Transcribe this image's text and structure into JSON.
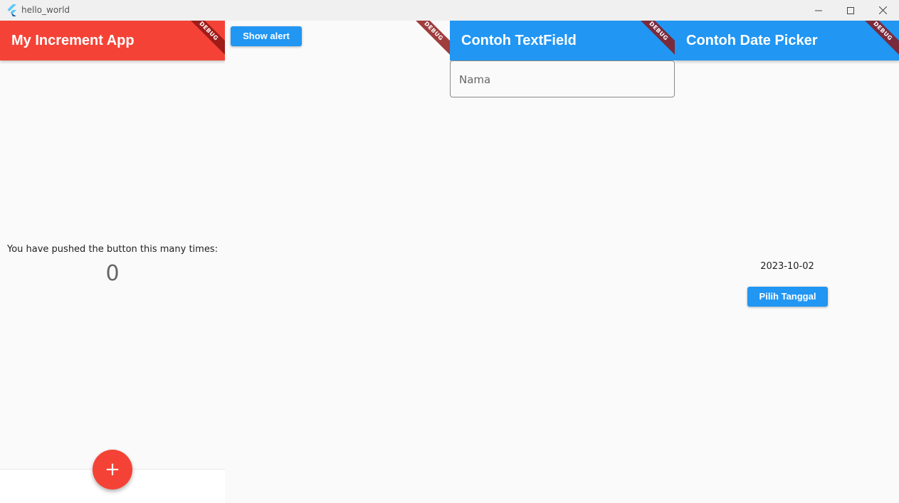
{
  "window": {
    "title": "hello_world"
  },
  "colors": {
    "red": "#f44336",
    "blue": "#2196f3"
  },
  "debug_banner": "DEBUG",
  "panes": {
    "increment": {
      "title": "My Increment App",
      "label": "You have pushed the button this many times:",
      "count": "0",
      "fab_label": "+"
    },
    "alert": {
      "button_label": "Show alert"
    },
    "textfield": {
      "title": "Contoh TextField",
      "placeholder": "Nama"
    },
    "datepicker": {
      "title": "Contoh Date Picker",
      "date": "2023-10-02",
      "button_label": "Pilih Tanggal"
    }
  }
}
